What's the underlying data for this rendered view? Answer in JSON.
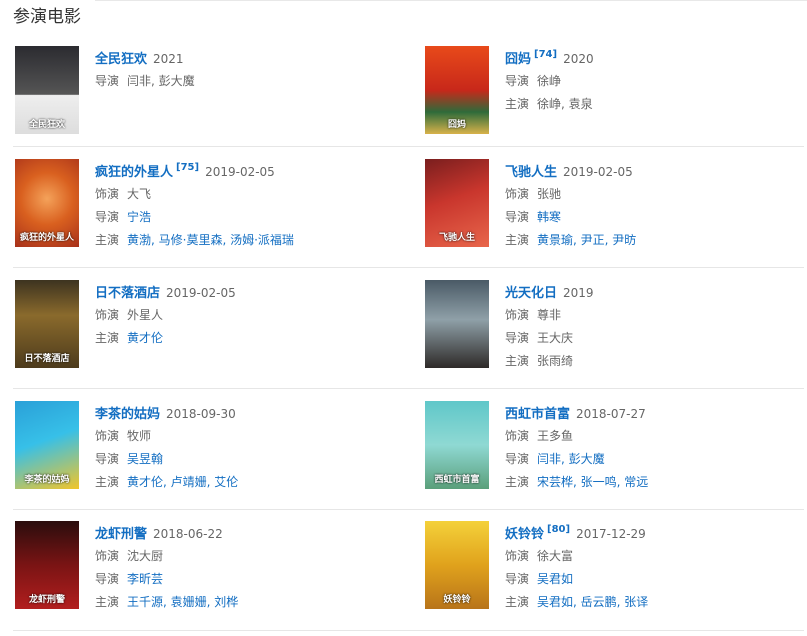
{
  "section": {
    "title": "参演电影"
  },
  "labels": {
    "role": "饰演",
    "director": "导演",
    "cast": "主演"
  },
  "movies": [
    {
      "title": "全民狂欢",
      "ref": "",
      "date": "2021",
      "director": "闫非, 彭大魔",
      "poster_text": "全民狂欢"
    },
    {
      "title": "囧妈",
      "ref": "[74]",
      "date": "2020",
      "director": "徐峥",
      "cast": "徐峥, 袁泉",
      "poster_text": "囧妈"
    },
    {
      "title": "疯狂的外星人",
      "ref": "[75]",
      "date": "2019-02-05",
      "role": "大飞",
      "director": "宁浩",
      "cast": "黄渤, 马修·莫里森, 汤姆·派福瑞",
      "poster_text": "疯狂的外星人"
    },
    {
      "title": "飞驰人生",
      "ref": "",
      "date": "2019-02-05",
      "role": "张驰",
      "director": "韩寒",
      "cast": "黄景瑜, 尹正, 尹昉",
      "poster_text": "飞驰人生"
    },
    {
      "title": "日不落酒店",
      "ref": "",
      "date": "2019-02-05",
      "role": "外星人",
      "cast": "黄才伦",
      "poster_text": "日不落酒店"
    },
    {
      "title": "光天化日",
      "ref": "",
      "date": "2019",
      "role": "尊非",
      "director": "王大庆",
      "cast": "张雨绮",
      "poster_text": ""
    },
    {
      "title": "李茶的姑妈",
      "ref": "",
      "date": "2018-09-30",
      "role": "牧师",
      "director": "吴昱翰",
      "cast": "黄才伦, 卢靖姗, 艾伦",
      "poster_text": "李茶的姑妈"
    },
    {
      "title": "西虹市首富",
      "ref": "",
      "date": "2018-07-27",
      "role": "王多鱼",
      "director": "闫非, 彭大魔",
      "cast": "宋芸桦, 张一鸣, 常远",
      "poster_text": "西虹市首富"
    },
    {
      "title": "龙虾刑警",
      "ref": "",
      "date": "2018-06-22",
      "role": "沈大厨",
      "director": "李昕芸",
      "cast": "王千源, 袁姗姗, 刘桦",
      "poster_text": "龙虾刑警"
    },
    {
      "title": "妖铃铃",
      "ref": "[80]",
      "date": "2017-12-29",
      "role": "徐大富",
      "director": "吴君如",
      "cast": "吴君如, 岳云鹏, 张译",
      "poster_text": "妖铃铃"
    }
  ],
  "colors": {
    "link": "#136ec2",
    "text": "#666666"
  }
}
